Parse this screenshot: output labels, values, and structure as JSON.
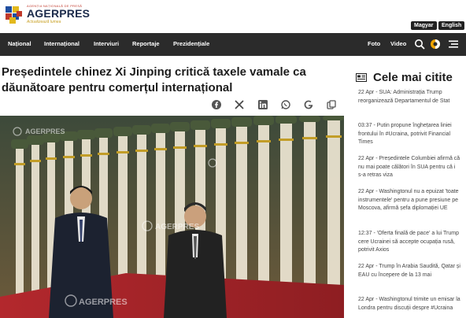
{
  "header": {
    "tag": "Agenția Națională de Presă",
    "brand": "AGERPRES",
    "slogan": "Actualizează lumea",
    "lang_hu": "Magyar",
    "lang_en": "English"
  },
  "nav": {
    "items": [
      "Național",
      "Internațional",
      "Interviuri",
      "Reportaje",
      "Prezidențiale"
    ],
    "foto": "Foto",
    "video": "Video"
  },
  "article": {
    "title": "Președintele chinez Xi Jinping critică taxele vamale ca dăunătoare pentru comerțul internațional",
    "watermark": "AGERPRES"
  },
  "sidebar": {
    "heading": "Cele mai citite",
    "items": [
      {
        "time": "22 Apr",
        "text": " - SUA: Administrația Trump reorganizează Departamentul de Stat"
      },
      {
        "time": "03:37",
        "text": " - Putin propune înghețarea liniei frontului în #Ucraina, potrivit Financial Times"
      },
      {
        "time": "22 Apr",
        "text": " - Președintele Columbiei afirmă că nu mai poate călători în SUA pentru că i s-a retras viza"
      },
      {
        "time": "22 Apr",
        "text": " - Washingtonul nu a epuizat 'toate instrumentele' pentru a pune presiune pe Moscova, afirmă șefa diplomației UE"
      },
      {
        "time": "12:37",
        "text": " - 'Oferta finală de pace' a lui Trump cere Ucrainei să accepte ocupația rusă, potrivit Axios"
      },
      {
        "time": "22 Apr",
        "text": " - Trump în Arabia Saudită, Qatar și EAU cu începere de la 13 mai"
      },
      {
        "time": "22 Apr",
        "text": " - Washingtonul trimite un emisar la Londra pentru discuții despre #Ucraina"
      }
    ]
  },
  "colors": {
    "nav_bg": "#2b2b2b",
    "brand_blue": "#1b2a4a",
    "accent_gold": "#c9a227",
    "sidebar_time": "#444444"
  }
}
